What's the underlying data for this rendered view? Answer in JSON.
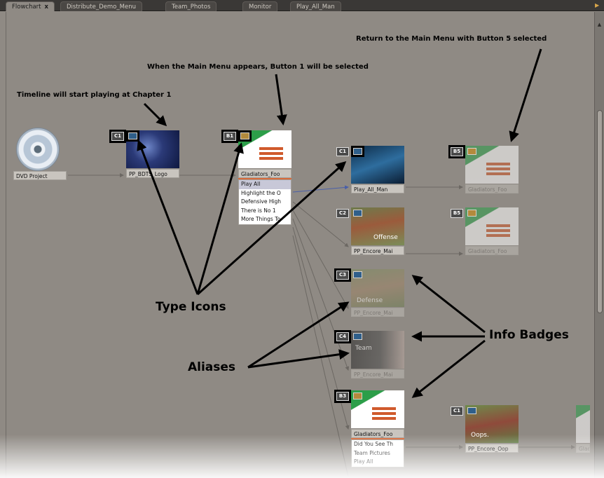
{
  "tabs": [
    {
      "label": "Flowchart",
      "active": true,
      "close": "x"
    },
    {
      "label": "Distribute_Demo_Menu",
      "active": false
    },
    {
      "label": "Team_Photos",
      "active": false
    },
    {
      "label": "Monitor",
      "active": false
    },
    {
      "label": "Play_All_Man",
      "active": false
    }
  ],
  "project": {
    "label": "DVD Project"
  },
  "nodes": {
    "logo": {
      "label": "PP_BDTS_Logo",
      "badge": "C1"
    },
    "main_menu": {
      "label": "Gladiators_Foo",
      "badge": "B1",
      "buttons": [
        "Play All",
        "Highlight the O",
        "Defensive High",
        "There is No 1",
        "More Things To"
      ]
    },
    "play_all": {
      "label": "Play_All_Man",
      "badge": "C1"
    },
    "return_menu": {
      "label": "Gladiators_Foo",
      "badge": "B5"
    },
    "encore": {
      "label": "PP_Encore_Mai",
      "badge": "C2"
    },
    "encore_return": {
      "label": "Gladiators_Foo",
      "badge": "B5"
    },
    "alias_defense": {
      "label": "PP_Encore_Mai",
      "badge": "C3",
      "overlay": "Defense"
    },
    "alias_team": {
      "label": "PP_Encore_Mai",
      "badge": "C4",
      "overlay": "Team"
    },
    "sub_menu": {
      "label": "Gladiators_Foo",
      "badge": "B3",
      "buttons": [
        "Did You See Th",
        "Team Pictures",
        "Play All"
      ]
    },
    "oops": {
      "label": "PP_Encore_Oop",
      "badge": "C1",
      "overlay": "Oops."
    },
    "encore_offense_overlay": "Offense",
    "edge_label": "Glad"
  },
  "callouts": {
    "timeline": "Timeline will start playing at Chapter 1",
    "main_menu": "When the Main Menu appears, Button 1 will be selected",
    "return": "Return to the Main Menu with Button 5 selected",
    "type_icons": "Type Icons",
    "aliases": "Aliases",
    "info_badges": "Info Badges"
  },
  "colors": {
    "canvas": "#8f8a84",
    "accent_green": "#2c9e49",
    "accent_orange": "#d05a2c"
  }
}
